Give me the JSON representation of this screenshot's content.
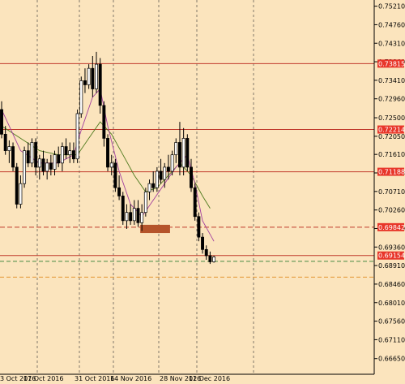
{
  "chart_data": {
    "type": "candlestick",
    "title": "",
    "xlabel": "",
    "ylabel": "",
    "ylim": [
      0.6627,
      0.7536
    ],
    "x_ticks": [
      "3 Oct 2016",
      "17 Oct 2016",
      "31 Oct 2016",
      "14 Nov 2016",
      "28 Nov 2016",
      "12 Dec 2016"
    ],
    "y_ticks": [
      "0.75210",
      "0.74760",
      "0.74310",
      "0.73860",
      "0.73410",
      "0.72960",
      "0.72500",
      "0.72050",
      "0.71610",
      "0.71160",
      "0.70710",
      "0.70260",
      "0.69810",
      "0.69360",
      "0.68910",
      "0.68460",
      "0.68010",
      "0.67560",
      "0.67110",
      "0.66650"
    ],
    "levels": [
      {
        "label": "0.73815",
        "value": 0.73815,
        "style": "solid",
        "color": "#c0392b"
      },
      {
        "label": "0.72214",
        "value": 0.72214,
        "style": "solid",
        "color": "#c0392b"
      },
      {
        "label": "0.71188",
        "value": 0.71188,
        "style": "solid",
        "color": "#c0392b"
      },
      {
        "label": "0.69842",
        "value": 0.69842,
        "style": "dashed",
        "color": "#c0392b"
      },
      {
        "label": "0.69154",
        "value": 0.69154,
        "style": "solid",
        "color": "#c0392b"
      }
    ],
    "extra_lines": [
      {
        "value": 0.69012,
        "style": "dashed",
        "color": "#2e7d32"
      },
      {
        "value": 0.6863,
        "style": "dashed",
        "color": "#e08a1e"
      }
    ],
    "candles": [
      [
        0.727,
        0.729,
        0.72,
        0.721
      ],
      [
        0.721,
        0.723,
        0.716,
        0.717
      ],
      [
        0.717,
        0.7195,
        0.714,
        0.718
      ],
      [
        0.718,
        0.719,
        0.712,
        0.713
      ],
      [
        0.713,
        0.714,
        0.703,
        0.704
      ],
      [
        0.704,
        0.711,
        0.703,
        0.709
      ],
      [
        0.709,
        0.718,
        0.708,
        0.717
      ],
      [
        0.717,
        0.719,
        0.713,
        0.714
      ],
      [
        0.714,
        0.72,
        0.713,
        0.719
      ],
      [
        0.719,
        0.72,
        0.711,
        0.713
      ],
      [
        0.713,
        0.716,
        0.71,
        0.715
      ],
      [
        0.715,
        0.717,
        0.711,
        0.712
      ],
      [
        0.712,
        0.715,
        0.71,
        0.714
      ],
      [
        0.714,
        0.716,
        0.711,
        0.7125
      ],
      [
        0.7125,
        0.717,
        0.711,
        0.716
      ],
      [
        0.716,
        0.718,
        0.713,
        0.714
      ],
      [
        0.714,
        0.719,
        0.712,
        0.718
      ],
      [
        0.718,
        0.72,
        0.715,
        0.716
      ],
      [
        0.716,
        0.719,
        0.714,
        0.717
      ],
      [
        0.717,
        0.719,
        0.714,
        0.715
      ],
      [
        0.715,
        0.727,
        0.714,
        0.726
      ],
      [
        0.726,
        0.735,
        0.725,
        0.734
      ],
      [
        0.734,
        0.737,
        0.731,
        0.733
      ],
      [
        0.733,
        0.738,
        0.732,
        0.737
      ],
      [
        0.737,
        0.74,
        0.73,
        0.732
      ],
      [
        0.732,
        0.741,
        0.731,
        0.738
      ],
      [
        0.738,
        0.7395,
        0.726,
        0.728
      ],
      [
        0.728,
        0.729,
        0.718,
        0.72
      ],
      [
        0.72,
        0.721,
        0.712,
        0.713
      ],
      [
        0.713,
        0.716,
        0.711,
        0.714
      ],
      [
        0.714,
        0.715,
        0.707,
        0.708
      ],
      [
        0.708,
        0.711,
        0.705,
        0.706
      ],
      [
        0.706,
        0.707,
        0.699,
        0.7
      ],
      [
        0.7,
        0.704,
        0.698,
        0.702
      ],
      [
        0.702,
        0.704,
        0.699,
        0.7
      ],
      [
        0.7,
        0.705,
        0.699,
        0.703
      ],
      [
        0.703,
        0.705,
        0.6985,
        0.6995
      ],
      [
        0.6995,
        0.704,
        0.6975,
        0.702
      ],
      [
        0.702,
        0.708,
        0.701,
        0.707
      ],
      [
        0.707,
        0.71,
        0.705,
        0.709
      ],
      [
        0.709,
        0.712,
        0.707,
        0.708
      ],
      [
        0.708,
        0.713,
        0.707,
        0.712
      ],
      [
        0.712,
        0.715,
        0.709,
        0.71
      ],
      [
        0.71,
        0.714,
        0.708,
        0.713
      ],
      [
        0.713,
        0.716,
        0.71,
        0.712
      ],
      [
        0.712,
        0.717,
        0.711,
        0.716
      ],
      [
        0.716,
        0.72,
        0.714,
        0.719
      ],
      [
        0.719,
        0.724,
        0.711,
        0.713
      ],
      [
        0.713,
        0.7225,
        0.711,
        0.72
      ],
      [
        0.72,
        0.721,
        0.712,
        0.713
      ],
      [
        0.713,
        0.715,
        0.707,
        0.708
      ],
      [
        0.708,
        0.709,
        0.7,
        0.701
      ],
      [
        0.701,
        0.702,
        0.695,
        0.696
      ],
      [
        0.696,
        0.697,
        0.692,
        0.693
      ],
      [
        0.693,
        0.694,
        0.6905,
        0.6915
      ],
      [
        0.6915,
        0.6925,
        0.6895,
        0.69
      ],
      [
        0.69,
        0.6915,
        0.6898,
        0.6912
      ]
    ],
    "ma_purple": [
      [
        0,
        0.727
      ],
      [
        5,
        0.717
      ],
      [
        10,
        0.714
      ],
      [
        15,
        0.714
      ],
      [
        19,
        0.716
      ],
      [
        21,
        0.722
      ],
      [
        24,
        0.73
      ],
      [
        26,
        0.732
      ],
      [
        28,
        0.723
      ],
      [
        31,
        0.712
      ],
      [
        34,
        0.704
      ],
      [
        37,
        0.701
      ],
      [
        40,
        0.705
      ],
      [
        43,
        0.709
      ],
      [
        46,
        0.713
      ],
      [
        49,
        0.716
      ],
      [
        51,
        0.709
      ],
      [
        53,
        0.7
      ],
      [
        56,
        0.695
      ]
    ],
    "ma_green": [
      [
        0,
        0.723
      ],
      [
        5,
        0.72
      ],
      [
        10,
        0.717
      ],
      [
        15,
        0.716
      ],
      [
        20,
        0.716
      ],
      [
        23,
        0.72
      ],
      [
        26,
        0.724
      ],
      [
        29,
        0.721
      ],
      [
        32,
        0.716
      ],
      [
        35,
        0.711
      ],
      [
        38,
        0.707
      ],
      [
        41,
        0.708
      ],
      [
        44,
        0.711
      ],
      [
        47,
        0.714
      ],
      [
        50,
        0.711
      ],
      [
        53,
        0.706
      ],
      [
        55,
        0.703
      ]
    ],
    "box": {
      "from": 37,
      "to": 44,
      "top": 0.699,
      "bottom": 0.697,
      "color": "#b5542b"
    }
  }
}
